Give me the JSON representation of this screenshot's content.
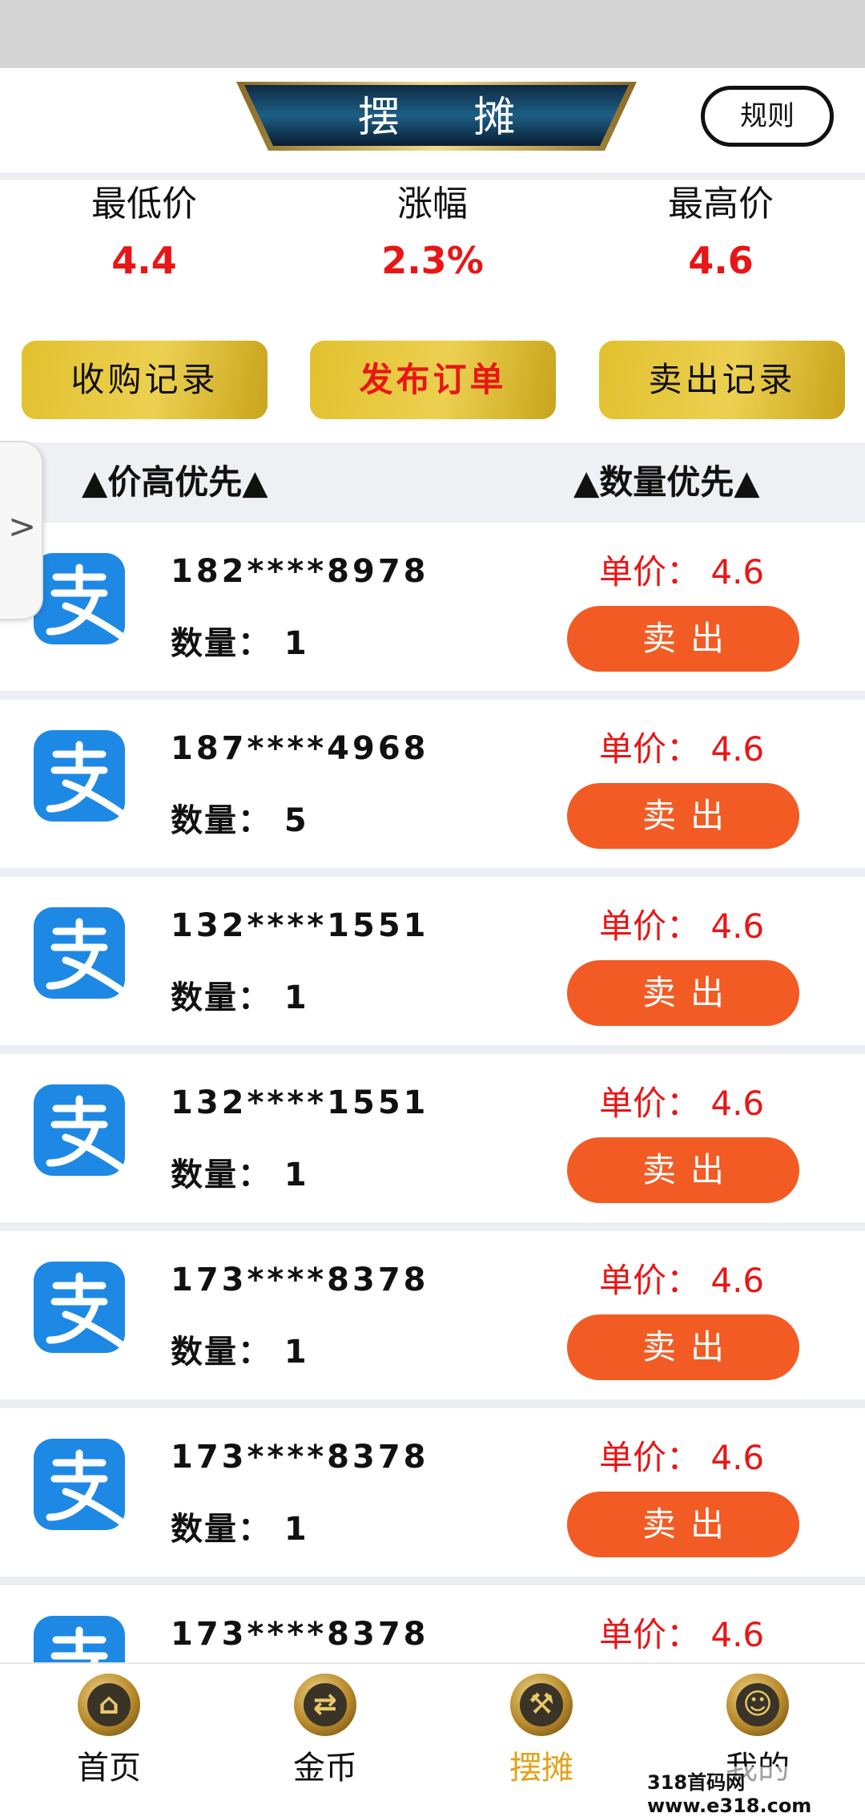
{
  "header": {
    "title": "摆 摊",
    "rules_label": "规则"
  },
  "stats": [
    {
      "label": "最低价",
      "value": "4.4"
    },
    {
      "label": "涨幅",
      "value": "2.3%"
    },
    {
      "label": "最高价",
      "value": "4.6"
    }
  ],
  "actions": {
    "buy_records": "收购记录",
    "publish_order": "发布订单",
    "sell_records": "卖出记录"
  },
  "sort": {
    "price_first": "▲价高优先▲",
    "quantity_first": "▲数量优先▲"
  },
  "side_handle": ">",
  "orders": [
    {
      "phone": "182****8978",
      "qty": "数量：  1",
      "price": "单价：  4.6",
      "sell": "卖出"
    },
    {
      "phone": "187****4968",
      "qty": "数量：  5",
      "price": "单价：  4.6",
      "sell": "卖出"
    },
    {
      "phone": "132****1551",
      "qty": "数量：  1",
      "price": "单价：  4.6",
      "sell": "卖出"
    },
    {
      "phone": "132****1551",
      "qty": "数量：  1",
      "price": "单价：  4.6",
      "sell": "卖出"
    },
    {
      "phone": "173****8378",
      "qty": "数量：  1",
      "price": "单价：  4.6",
      "sell": "卖出"
    },
    {
      "phone": "173****8378",
      "qty": "数量：  1",
      "price": "单价：  4.6",
      "sell": "卖出"
    },
    {
      "phone": "173****8378",
      "qty": "",
      "price": "单价：  4.6",
      "sell": ""
    }
  ],
  "tabs": [
    {
      "label": "首页",
      "icon": "home-icon",
      "glyph": "⌂"
    },
    {
      "label": "金币",
      "icon": "coin-exchange-icon",
      "glyph": "⇄"
    },
    {
      "label": "摆摊",
      "icon": "auction-hammer-icon",
      "glyph": "⚒",
      "active": true
    },
    {
      "label": "我的",
      "icon": "user-icon",
      "glyph": "☺"
    }
  ],
  "watermark": "318首码网 www.e318.com",
  "colors": {
    "accent_red": "#e81616",
    "sell_orange": "#f25b23",
    "gold": "#e2c12e",
    "tab_active": "#e3a21a",
    "alipay_blue": "#1e88e5"
  }
}
